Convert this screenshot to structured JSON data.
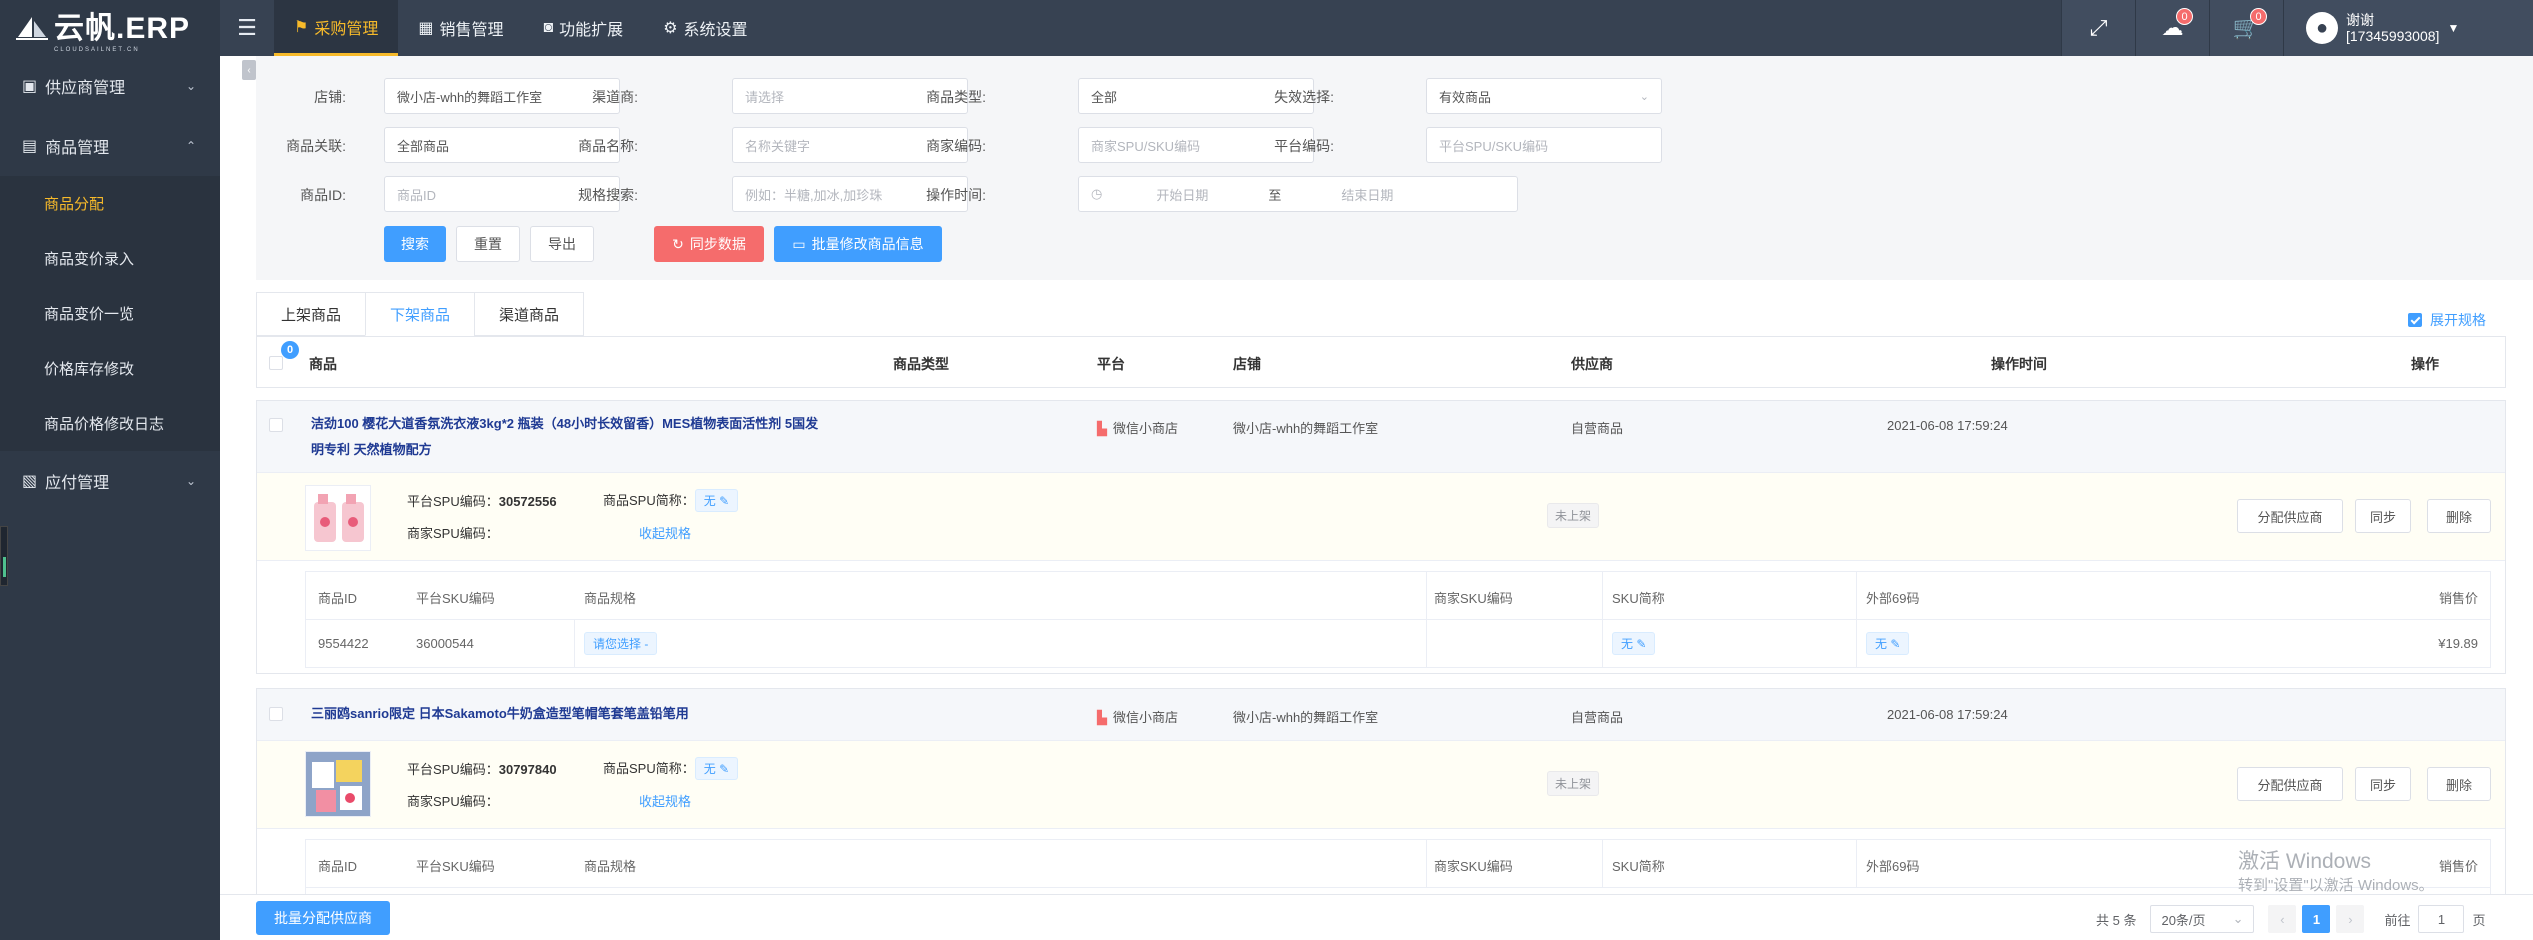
{
  "brand": {
    "name": "云帆.ERP",
    "sub": "CLOUDSAILNET.CN"
  },
  "topnav": [
    {
      "label": "采购管理",
      "icon": "purchase-icon",
      "active": true
    },
    {
      "label": "销售管理",
      "icon": "sales-icon",
      "active": false
    },
    {
      "label": "功能扩展",
      "icon": "extension-icon",
      "active": false
    },
    {
      "label": "系统设置",
      "icon": "settings-icon",
      "active": false
    }
  ],
  "header": {
    "notify_badge": "0",
    "cart_badge": "0",
    "user_name": "谢谢",
    "user_phone": "[17345993008]"
  },
  "sidebar": {
    "groups": [
      {
        "label": "供应商管理",
        "icon": "supplier-icon",
        "expanded": false
      },
      {
        "label": "商品管理",
        "icon": "goods-icon",
        "expanded": true
      },
      {
        "label": "应付管理",
        "icon": "payable-icon",
        "expanded": false
      }
    ],
    "sub_items": [
      {
        "label": "商品分配",
        "active": true
      },
      {
        "label": "商品变价录入",
        "active": false
      },
      {
        "label": "商品变价一览",
        "active": false
      },
      {
        "label": "价格库存修改",
        "active": false
      },
      {
        "label": "商品价格修改日志",
        "active": false
      }
    ]
  },
  "filters": {
    "shop": {
      "label": "店铺:",
      "value": "微小店-whh的舞蹈工作室"
    },
    "channel": {
      "label": "渠道商:",
      "placeholder": "请选择"
    },
    "goods_type": {
      "label": "商品类型:",
      "value": "全部"
    },
    "invalid": {
      "label": "失效选择:",
      "value": "有效商品"
    },
    "relation": {
      "label": "商品关联:",
      "value": "全部商品"
    },
    "goods_name": {
      "label": "商品名称:",
      "placeholder": "名称关键字"
    },
    "merchant_code": {
      "label": "商家编码:",
      "placeholder": "商家SPU/SKU编码"
    },
    "platform_code": {
      "label": "平台编码:",
      "placeholder": "平台SPU/SKU编码"
    },
    "goods_id": {
      "label": "商品ID:",
      "placeholder": "商品ID"
    },
    "spec_search": {
      "label": "规格搜索:",
      "placeholder": "例如：半糖,加冰,加珍珠"
    },
    "op_time": {
      "label": "操作时间:",
      "start_placeholder": "开始日期",
      "sep": "至",
      "end_placeholder": "结束日期"
    }
  },
  "actions": {
    "search": "搜索",
    "reset": "重置",
    "export": "导出",
    "sync": "同步数据",
    "batch_edit": "批量修改商品信息"
  },
  "tabs": [
    {
      "label": "上架商品",
      "active": false
    },
    {
      "label": "下架商品",
      "active": true
    },
    {
      "label": "渠道商品",
      "active": false
    }
  ],
  "expand_spec": {
    "label": "展开规格",
    "checked": true
  },
  "table": {
    "selected_count": "0",
    "headers": {
      "goods": "商品",
      "goods_type": "商品类型",
      "platform": "平台",
      "shop": "店铺",
      "supplier": "供应商",
      "op_time": "操作时间",
      "op": "操作"
    },
    "sku_headers": {
      "id": "商品ID",
      "platform_sku": "平台SKU编码",
      "spec": "商品规格",
      "merchant_sku": "商家SKU编码",
      "sku_short": "SKU简称",
      "ext69": "外部69码",
      "price": "销售价"
    },
    "spu_labels": {
      "platform_spu": "平台SPU编码：",
      "merchant_spu": "商家SPU编码：",
      "spu_short": "商品SPU简称：",
      "collapse": "收起规格"
    },
    "row_buttons": {
      "assign": "分配供应商",
      "sync": "同步",
      "delete": "删除"
    },
    "products": [
      {
        "title_line1": "洁劲100 樱花大道香氛洗衣液3kg*2 瓶装（48小时长效留香）MES植物表面活性剂 5国发",
        "title_line2": "明专利 天然植物配方",
        "platform": "微信小商店",
        "shop": "微小店-whh的舞蹈工作室",
        "supplier": "自营商品",
        "op_time": "2021-06-08 17:59:24",
        "platform_spu": "30572556",
        "merchant_spu": "",
        "spu_short": "无",
        "status": "未上架",
        "skus": [
          {
            "id": "9554422",
            "platform_sku": "36000544",
            "spec": "请您选择 -",
            "merchant_sku": "",
            "sku_short": "无",
            "ext69": "无",
            "price": "¥19.89"
          }
        ]
      },
      {
        "title_line1": "三丽鸥sanrio限定 日本Sakamoto牛奶盒造型笔帽笔套笔盖铅笔用",
        "title_line2": "",
        "platform": "微信小商店",
        "shop": "微小店-whh的舞蹈工作室",
        "supplier": "自营商品",
        "op_time": "2021-06-08 17:59:24",
        "platform_spu": "30797840",
        "merchant_spu": "",
        "spu_short": "无",
        "status": "未上架",
        "skus": []
      }
    ]
  },
  "footer": {
    "batch_assign": "批量分配供应商",
    "total": "共 5 条",
    "page_size": "20条/页",
    "current_page": "1",
    "goto_label": "前往",
    "goto_value": "1",
    "page_unit": "页"
  },
  "watermark": {
    "line1": "激活 Windows",
    "line2": "转到\"设置\"以激活 Windows。"
  }
}
